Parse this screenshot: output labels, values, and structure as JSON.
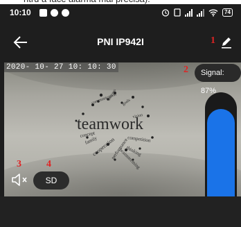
{
  "status_bar": {
    "time": "10:10",
    "battery": "74"
  },
  "header": {
    "title": "PNI IP942I"
  },
  "annotations": [
    "1",
    "2",
    "3",
    "4"
  ],
  "video": {
    "timestamp": "2020- 10- 27  10: 10: 30",
    "signal": "Signal: 87%"
  },
  "controls": {
    "quality_label": "SD",
    "talk_level": 0.88
  },
  "colors": {
    "accent": "#1a73e8",
    "annotation": "#e02424"
  }
}
